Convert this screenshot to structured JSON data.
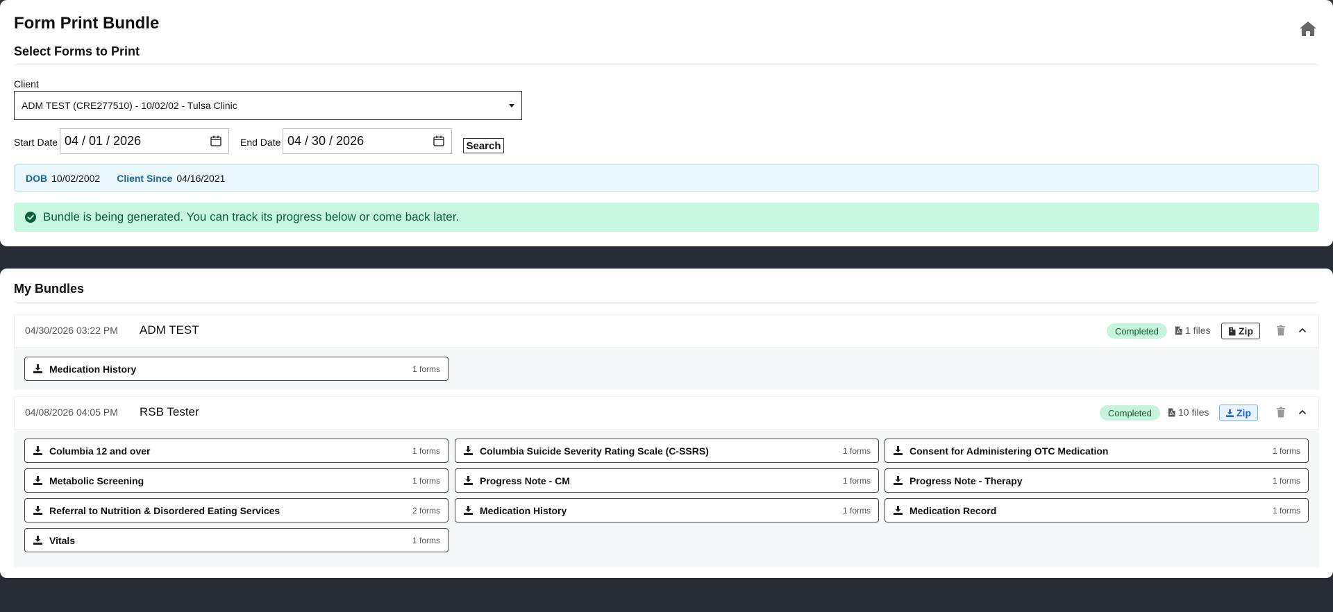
{
  "header": {
    "title": "Form Print Bundle",
    "section_title": "Select Forms to Print"
  },
  "client": {
    "label": "Client",
    "selected": "ADM TEST (CRE277510) - 10/02/02 - Tulsa Clinic"
  },
  "dates": {
    "start_label": "Start Date",
    "start_value": "04 / 01 / 2026",
    "end_label": "End Date",
    "end_value": "04 / 30 / 2026",
    "search_label": "Search"
  },
  "info": {
    "dob_label": "DOB",
    "dob_value": "10/02/2002",
    "since_label": "Client Since",
    "since_value": "04/16/2021"
  },
  "alert": {
    "message": "Bundle is being generated. You can track its progress below or come back later."
  },
  "bundles_title": "My Bundles",
  "bundles": [
    {
      "date": "04/30/2026 03:22 PM",
      "name": "ADM TEST",
      "status": "Completed",
      "files": "1 files",
      "zip_label": "Zip",
      "forms": [
        {
          "name": "Medication History",
          "count": "1 forms"
        }
      ]
    },
    {
      "date": "04/08/2026 04:05 PM",
      "name": "RSB Tester",
      "status": "Completed",
      "files": "10 files",
      "zip_label": "Zip",
      "forms": [
        {
          "name": "Columbia 12 and over",
          "count": "1 forms"
        },
        {
          "name": "Columbia Suicide Severity Rating Scale (C-SSRS)",
          "count": "1 forms"
        },
        {
          "name": "Consent for Administering OTC Medication",
          "count": "1 forms"
        },
        {
          "name": "Metabolic Screening",
          "count": "1 forms"
        },
        {
          "name": "Progress Note - CM",
          "count": "1 forms"
        },
        {
          "name": "Progress Note - Therapy",
          "count": "1 forms"
        },
        {
          "name": "Referral to Nutrition & Disordered Eating Services",
          "count": "2 forms"
        },
        {
          "name": "Medication History",
          "count": "1 forms"
        },
        {
          "name": "Medication Record",
          "count": "1 forms"
        },
        {
          "name": "Vitals",
          "count": "1 forms"
        }
      ]
    }
  ],
  "icons": {
    "home": "home-icon",
    "calendar": "calendar-icon",
    "check": "check-circle-icon",
    "pdf": "file-pdf-icon",
    "zip": "file-zip-icon",
    "download": "download-icon",
    "trash": "trash-icon",
    "chevron": "chevron-up-icon"
  },
  "colors": {
    "page_bg": "#272c35",
    "info_label": "#1a6598",
    "success_bg": "#c8f7e1",
    "success_text": "#0c5d3a",
    "badge_bg": "#c6f3dc",
    "zip_blue": "#1d63c6"
  }
}
